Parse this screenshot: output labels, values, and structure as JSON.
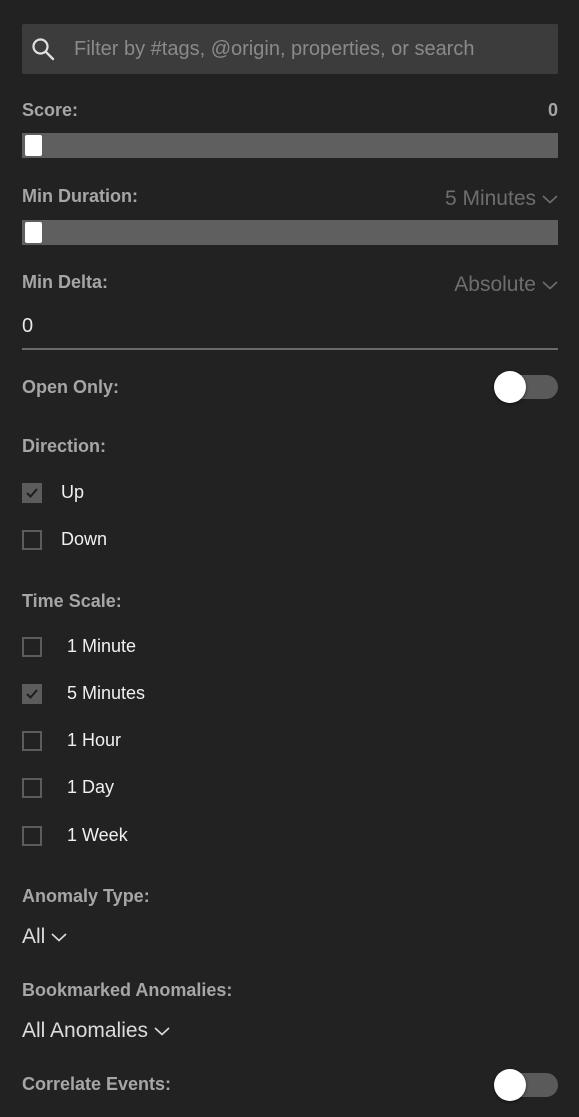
{
  "search": {
    "placeholder": "Filter by #tags, @origin, properties, or search",
    "icon": "search-icon"
  },
  "score": {
    "label": "Score:",
    "value": "0",
    "level": 0
  },
  "min_duration": {
    "label": "Min Duration:",
    "selected": "5 Minutes",
    "level": 0
  },
  "min_delta": {
    "label": "Min Delta:",
    "selected": "Absolute",
    "value": "0"
  },
  "open_only": {
    "label": "Open Only:",
    "on": false
  },
  "direction": {
    "label": "Direction:",
    "options": [
      {
        "label": "Up",
        "checked": true
      },
      {
        "label": "Down",
        "checked": false
      }
    ]
  },
  "time_scale": {
    "label": "Time Scale:",
    "options": [
      {
        "label": "1 Minute",
        "checked": false
      },
      {
        "label": "5 Minutes",
        "checked": true
      },
      {
        "label": "1 Hour",
        "checked": false
      },
      {
        "label": "1 Day",
        "checked": false
      },
      {
        "label": "1 Week",
        "checked": false
      }
    ]
  },
  "anomaly_type": {
    "label": "Anomaly Type:",
    "selected": "All"
  },
  "bookmarked": {
    "label": "Bookmarked Anomalies:",
    "selected": "All Anomalies"
  },
  "correlate": {
    "label": "Correlate Events:",
    "on": false
  },
  "colors": {
    "background": "#222222",
    "track": "#5f5f5f",
    "label": "#a6a6a6",
    "checkbox": "#5c5c5c"
  }
}
